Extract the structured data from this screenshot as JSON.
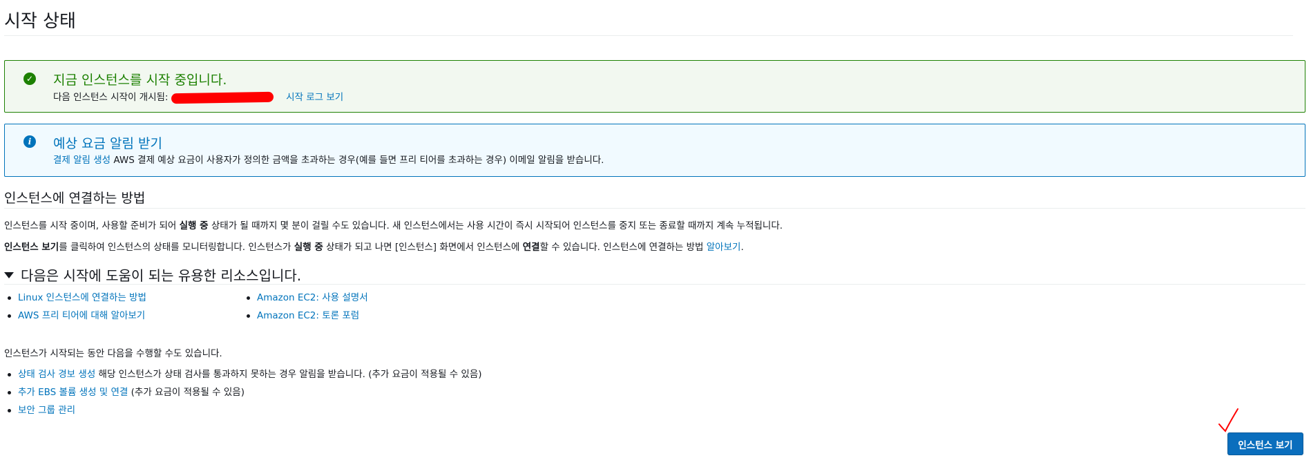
{
  "page": {
    "title": "시작 상태"
  },
  "success_alert": {
    "icon": "check-circle-icon",
    "title": "지금 인스턴스를 시작 중입니다.",
    "body_prefix": "다음 인스턴스 시작이 개시됨:",
    "link": "시작 로그 보기"
  },
  "info_alert": {
    "icon": "info-circle-icon",
    "title": "예상 요금 알림 받기",
    "link": "결제 알림 생성",
    "body": " AWS 결제 예상 요금이 사용자가 정의한 금액을 초과하는 경우(예를 들면 프리 티어를 초과하는 경우) 이메일 알림을 받습니다."
  },
  "connect_section": {
    "title": "인스턴스에 연결하는 방법",
    "para1": {
      "text_a": "인스턴스를 시작 중이며, 사용할 준비가 되어 ",
      "bold": "실행 중",
      "text_b": " 상태가 될 때까지 몇 분이 걸릴 수도 있습니다. 새 인스턴스에서는 사용 시간이 즉시 시작되어 인스턴스를 중지 또는 종료할 때까지 계속 누적됩니다."
    },
    "para2": {
      "bold_a": "인스턴스 보기",
      "text_a": "를 클릭하여 인스턴스의 상태를 모니터링합니다. 인스턴스가 ",
      "bold_b": "실행 중",
      "text_b": " 상태가 되고 나면 [인스턴스] 화면에서 인스턴스에 ",
      "bold_c": "연결",
      "text_c": "할 수 있습니다. 인스턴스에 연결하는 방법 ",
      "link": "알아보기",
      "text_d": "."
    }
  },
  "resources": {
    "title": "다음은 시작에 도움이 되는 유용한 리소스입니다.",
    "col1": [
      "Linux 인스턴스에 연결하는 방법",
      "AWS 프리 티어에 대해 알아보기"
    ],
    "col2": [
      "Amazon EC2: 사용 설명서",
      "Amazon EC2: 토론 포럼"
    ]
  },
  "while_launching": {
    "intro": "인스턴스가 시작되는 동안 다음을 수행할 수도 있습니다.",
    "items": [
      {
        "link": "상태 검사 경보 생성",
        "text": " 해당 인스턴스가 상태 검사를 통과하지 못하는 경우 알림을 받습니다. (추가 요금이 적용될 수 있음)"
      },
      {
        "link": "추가 EBS 볼륨 생성 및 연결",
        "text": " (추가 요금이 적용될 수 있음)"
      },
      {
        "link": "보안 그룹 관리",
        "text": ""
      }
    ]
  },
  "footer": {
    "view_instances_button": "인스턴스 보기"
  },
  "colors": {
    "success": "#1d8102",
    "info": "#0073bb",
    "link": "#0073bb",
    "primary_button": "#0a6ebd",
    "redaction": "#ff0000"
  }
}
